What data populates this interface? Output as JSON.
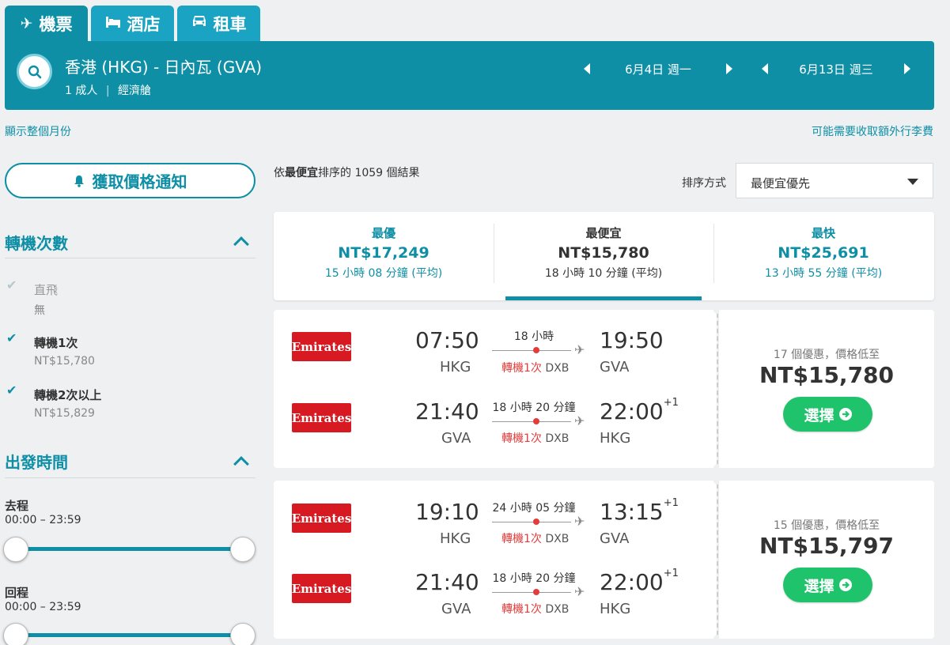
{
  "tabs": [
    {
      "label": "機票",
      "icon": "✈"
    },
    {
      "label": "酒店",
      "icon": "🛏"
    },
    {
      "label": "租車",
      "icon": "🚘"
    }
  ],
  "search": {
    "route": "香港 (HKG) - 日內瓦 (GVA)",
    "passengers": "1 成人",
    "cabin": "經濟艙",
    "depart_date": "6月4日 週一",
    "return_date": "6月13日 週三"
  },
  "links": {
    "show_month": "顯示整個月份",
    "baggage_fee": "可能需要收取額外行李費"
  },
  "alert_button": "獲取價格通知",
  "stops_filter": {
    "title": "轉機次數",
    "options": [
      {
        "label": "直飛",
        "price": "無",
        "checked": true,
        "disabled": true
      },
      {
        "label": "轉機1次",
        "price": "NT$15,780",
        "checked": true,
        "disabled": false
      },
      {
        "label": "轉機2次以上",
        "price": "NT$15,829",
        "checked": true,
        "disabled": false
      }
    ]
  },
  "time_filter": {
    "title": "出發時間",
    "outbound_label": "去程",
    "outbound_range": "00:00 – 23:59",
    "return_label": "回程",
    "return_range": "00:00 – 23:59"
  },
  "results": {
    "prefix": "依",
    "bold": "最便宜",
    "suffix": "排序的 1059 個結果",
    "sort_label": "排序方式",
    "sort_value": "最便宜優先"
  },
  "summary": [
    {
      "label": "最優",
      "price": "NT$17,249",
      "duration": "15 小時 08 分鐘 (平均)"
    },
    {
      "label": "最便宜",
      "price": "NT$15,780",
      "duration": "18 小時 10 分鐘 (平均)"
    },
    {
      "label": "最快",
      "price": "NT$25,691",
      "duration": "13 小時 55 分鐘 (平均)"
    }
  ],
  "flights": [
    {
      "deals": "17 個優惠，價格低至",
      "price": "NT$15,780",
      "button": "選擇",
      "legs": [
        {
          "airline": "Emirates",
          "dep_time": "07:50",
          "dep_code": "HKG",
          "duration": "18 小時",
          "stops": "轉機1次",
          "via": "DXB",
          "arr_time": "19:50",
          "arr_sup": "",
          "arr_code": "GVA"
        },
        {
          "airline": "Emirates",
          "dep_time": "21:40",
          "dep_code": "GVA",
          "duration": "18 小時 20 分鐘",
          "stops": "轉機1次",
          "via": "DXB",
          "arr_time": "22:00",
          "arr_sup": "+1",
          "arr_code": "HKG"
        }
      ]
    },
    {
      "deals": "15 個優惠，價格低至",
      "price": "NT$15,797",
      "button": "選擇",
      "legs": [
        {
          "airline": "Emirates",
          "dep_time": "19:10",
          "dep_code": "HKG",
          "duration": "24 小時 05 分鐘",
          "stops": "轉機1次",
          "via": "DXB",
          "arr_time": "13:15",
          "arr_sup": "+1",
          "arr_code": "GVA"
        },
        {
          "airline": "Emirates",
          "dep_time": "21:40",
          "dep_code": "GVA",
          "duration": "18 小時 20 分鐘",
          "stops": "轉機1次",
          "via": "DXB",
          "arr_time": "22:00",
          "arr_sup": "+1",
          "arr_code": "HKG"
        }
      ]
    }
  ],
  "colors": {
    "brand": "#0e8fa6",
    "tab": "#1aa3c2",
    "select": "#1ec36b",
    "stop": "#e43c3c",
    "airline": "#d71921"
  }
}
